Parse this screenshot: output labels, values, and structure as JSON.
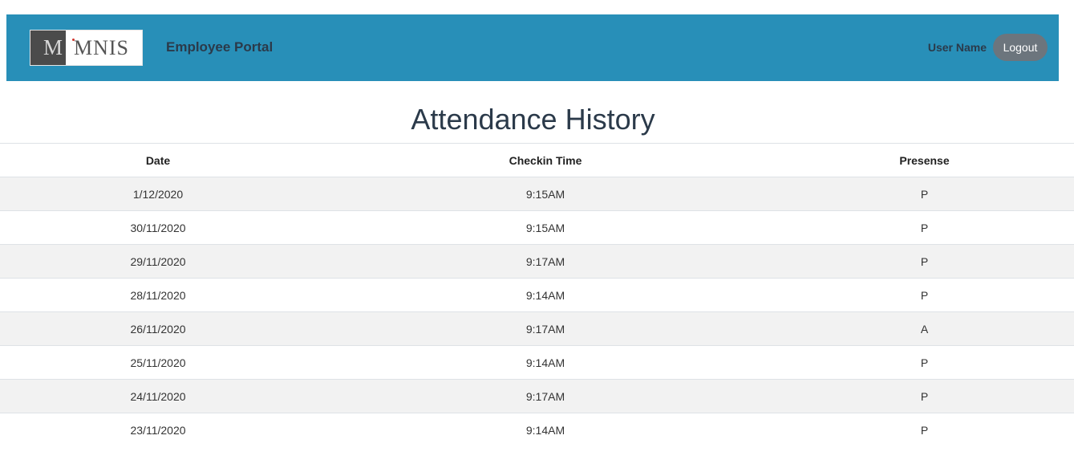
{
  "header": {
    "logo": {
      "left": "M",
      "right": "MNIS"
    },
    "title": "Employee Portal",
    "user_name": "User Name",
    "logout_label": "Logout"
  },
  "page_title": "Attendance History",
  "table": {
    "columns": [
      "Date",
      "Checkin Time",
      "Presense"
    ],
    "rows": [
      [
        "1/12/2020",
        "9:15AM",
        "P"
      ],
      [
        "30/11/2020",
        "9:15AM",
        "P"
      ],
      [
        "29/11/2020",
        "9:17AM",
        "P"
      ],
      [
        "28/11/2020",
        "9:14AM",
        "P"
      ],
      [
        "26/11/2020",
        "9:17AM",
        "A"
      ],
      [
        "25/11/2020",
        "9:14AM",
        "P"
      ],
      [
        "24/11/2020",
        "9:17AM",
        "P"
      ],
      [
        "23/11/2020",
        "9:14AM",
        "P"
      ]
    ]
  },
  "colors": {
    "navbar": "#288fb8",
    "logout_button": "#6c757d",
    "row_stripe": "#f2f2f2"
  }
}
